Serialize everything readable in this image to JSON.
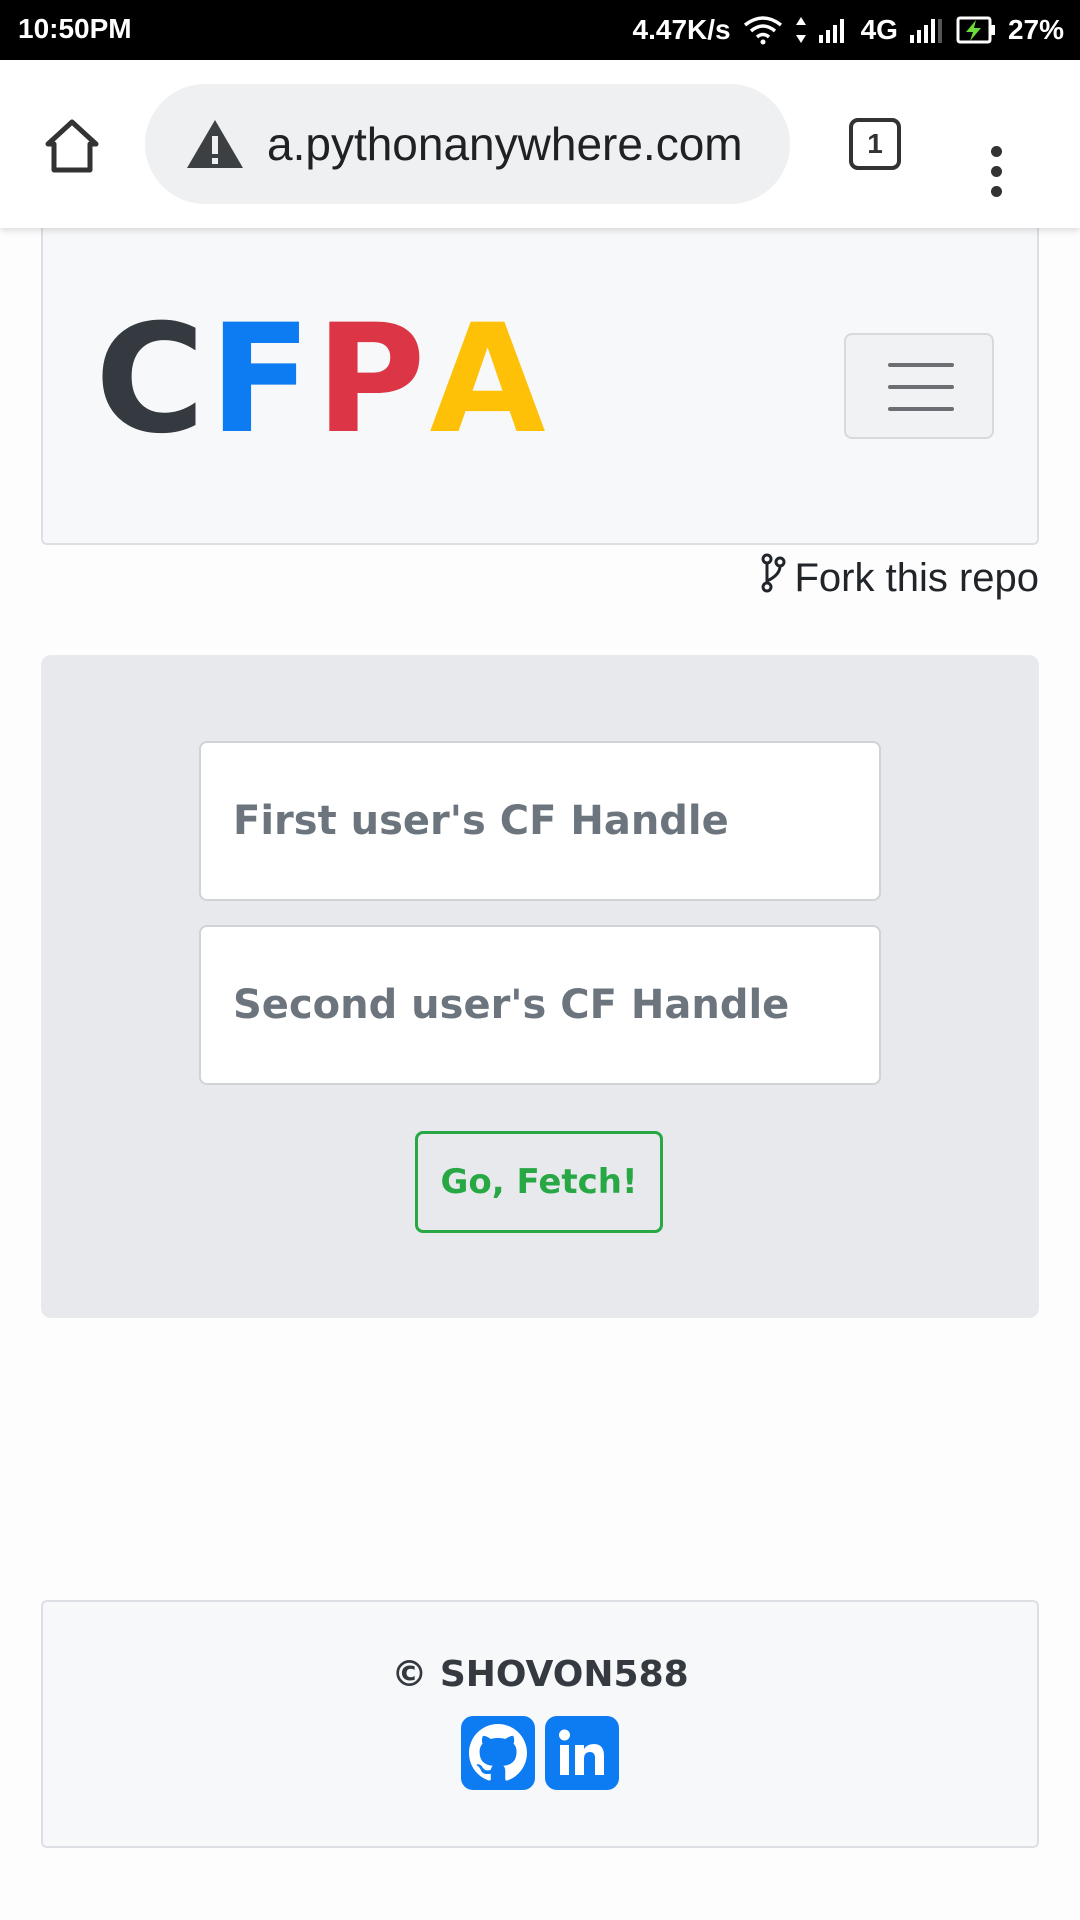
{
  "status_bar": {
    "time": "10:50PM",
    "net_speed": "4.47K/s",
    "network_type": "4G",
    "battery": "27%"
  },
  "browser": {
    "url": "a.pythonanywhere.com",
    "tab_count": "1"
  },
  "navbar": {
    "logo_letters": [
      "C",
      "F",
      "P",
      "A"
    ],
    "logo_colors": [
      "#343a40",
      "#0d7bf2",
      "#dc3545",
      "#ffc107"
    ]
  },
  "fork_link": {
    "label": "Fork this repo"
  },
  "form": {
    "first_handle_placeholder": "First user's CF Handle",
    "second_handle_placeholder": "Second user's CF Handle",
    "first_handle_value": "",
    "second_handle_value": "",
    "submit_label": "Go, Fetch!"
  },
  "footer": {
    "copyright": "© SHOVON588",
    "social": [
      "github-icon",
      "linkedin-icon"
    ]
  },
  "colors": {
    "success": "#28a745",
    "primary": "#0d7bf2",
    "danger": "#dc3545",
    "warning": "#ffc107",
    "dark": "#343a40"
  }
}
